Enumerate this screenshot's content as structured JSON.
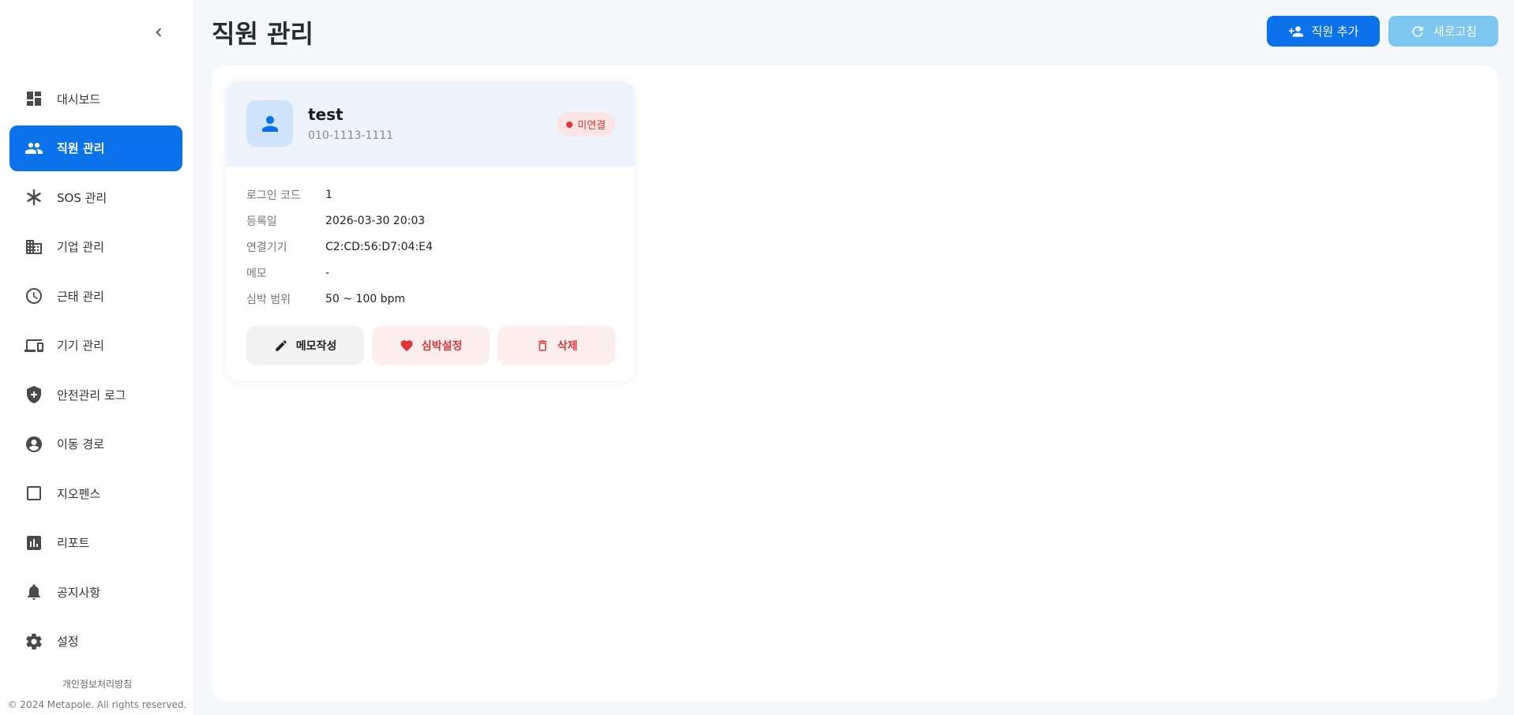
{
  "sidebar": {
    "items": [
      {
        "label": "대시보드",
        "icon": "dashboard-icon",
        "active": false
      },
      {
        "label": "직원 관리",
        "icon": "people-icon",
        "active": true
      },
      {
        "label": "SOS 관리",
        "icon": "asterisk-icon",
        "active": false
      },
      {
        "label": "기업 관리",
        "icon": "building-icon",
        "active": false
      },
      {
        "label": "근태 관리",
        "icon": "clock-icon",
        "active": false
      },
      {
        "label": "기기 관리",
        "icon": "devices-icon",
        "active": false
      },
      {
        "label": "안전관리 로그",
        "icon": "shield-icon",
        "active": false
      },
      {
        "label": "이동 경로",
        "icon": "person-pin-icon",
        "active": false
      },
      {
        "label": "지오펜스",
        "icon": "square-icon",
        "active": false
      },
      {
        "label": "리포트",
        "icon": "bar-chart-icon",
        "active": false
      },
      {
        "label": "공지사항",
        "icon": "bell-icon",
        "active": false
      },
      {
        "label": "설정",
        "icon": "gear-icon",
        "active": false
      }
    ],
    "privacy_link": "개인정보처리방침",
    "copyright": "© 2024 Metapole. All rights reserved."
  },
  "header": {
    "title": "직원 관리",
    "add_button": "직원 추가",
    "refresh_button": "새로고침"
  },
  "employees": [
    {
      "name": "test",
      "phone": "010-1113-1111",
      "status": "미연결",
      "fields": [
        {
          "label": "로그인 코드",
          "value": "1"
        },
        {
          "label": "등록일",
          "value": "2026-03-30 20:03"
        },
        {
          "label": "연결기기",
          "value": "C2:CD:56:D7:04:E4"
        },
        {
          "label": "메모",
          "value": "-"
        },
        {
          "label": "심박 범위",
          "value": "50 ~ 100 bpm"
        }
      ],
      "actions": {
        "memo": "메모작성",
        "heart": "심박설정",
        "delete": "삭제"
      }
    }
  ]
}
